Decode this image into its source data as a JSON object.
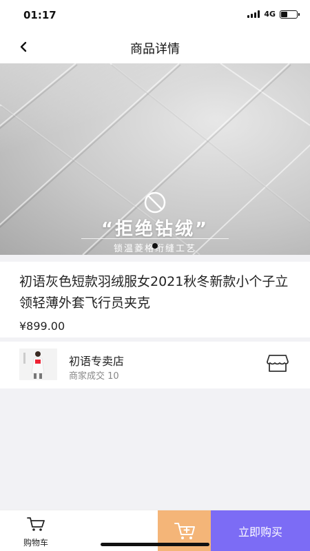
{
  "status_bar": {
    "time": "01:17",
    "network": "4G",
    "battery_level": 0.4
  },
  "nav": {
    "title": "商品详情",
    "back_icon": "chevron-left-icon"
  },
  "banner": {
    "headline": "“拒绝钻绒”",
    "subtitle": "锁温菱格绗缝工艺",
    "icon": "prohibited-icon",
    "slide_count": 1,
    "active_slide": 1
  },
  "product": {
    "title": "初语灰色短款羽绒服女2021秋冬新款小个子立领轻薄外套飞行员夹克",
    "price": "¥899.00"
  },
  "shop": {
    "name": "初语专卖店",
    "deals": "商家成交 10",
    "store_icon": "store-icon"
  },
  "bottom_bar": {
    "cart_label": "购物车",
    "cart_icon": "cart-icon",
    "add_cart_icon": "cart-add-icon",
    "buy_label": "立即购买",
    "colors": {
      "add_cart": "#f4b578",
      "buy": "#7c6cf5"
    }
  }
}
